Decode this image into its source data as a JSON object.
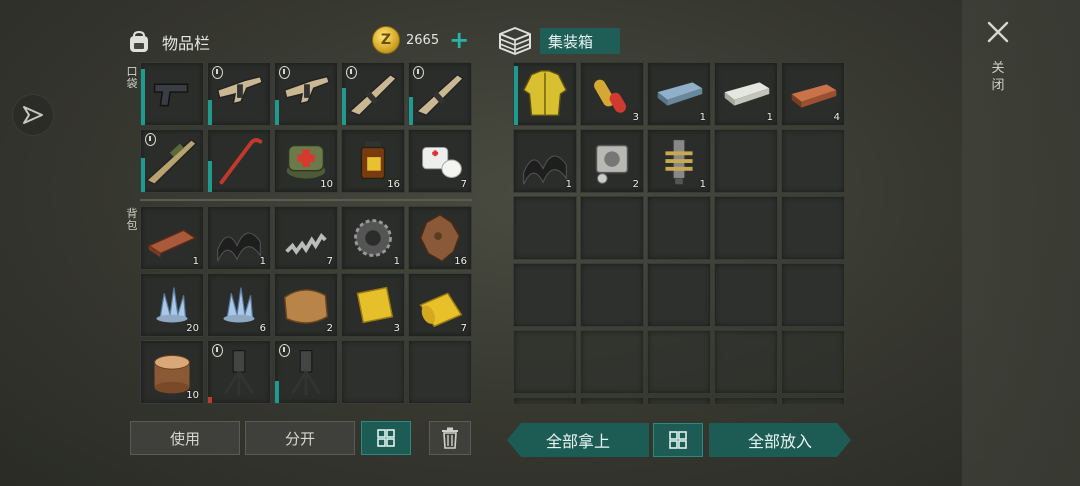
{
  "inventory": {
    "title": "物品栏",
    "pocket_label": "口袋",
    "backpack_label": "背包",
    "coins": "2665",
    "coin_symbol": "Z"
  },
  "box": {
    "title": "集装箱"
  },
  "close": {
    "label": "关闭"
  },
  "buttons": {
    "use": "使用",
    "split": "分开",
    "take_all": "全部拿上",
    "put_all": "全部放入"
  },
  "pocket_items": [
    {
      "name": "pistol-icon",
      "count": "",
      "durability": 0.9,
      "shield": false
    },
    {
      "name": "smg-icon",
      "count": "",
      "durability": 0.4,
      "shield": true
    },
    {
      "name": "smg-icon",
      "count": "",
      "durability": 0.4,
      "shield": true
    },
    {
      "name": "assault-rifle-icon",
      "count": "",
      "durability": 0.6,
      "shield": true
    },
    {
      "name": "assault-rifle-icon",
      "count": "",
      "durability": 0.45,
      "shield": true
    },
    {
      "name": "shotgun-icon",
      "count": "",
      "durability": 0.55,
      "shield": true
    },
    {
      "name": "crowbar-icon",
      "count": "",
      "durability": 0.5,
      "shield": false
    },
    {
      "name": "medkit-bag-icon",
      "count": "10"
    },
    {
      "name": "medicine-bottle-icon",
      "count": "16"
    },
    {
      "name": "bandage-icon",
      "count": "7"
    }
  ],
  "backpack_items": [
    {
      "name": "wood-plank-icon",
      "count": "1"
    },
    {
      "name": "rubber-sheet-icon",
      "count": "1"
    },
    {
      "name": "spring-icon",
      "count": "7"
    },
    {
      "name": "gear-icon",
      "count": "1"
    },
    {
      "name": "hide-icon",
      "count": "16"
    },
    {
      "name": "crystal-icon",
      "count": "20"
    },
    {
      "name": "crystal-icon",
      "count": "6"
    },
    {
      "name": "leather-icon",
      "count": "2"
    },
    {
      "name": "yellow-cloth-icon",
      "count": "3"
    },
    {
      "name": "fabric-roll-icon",
      "count": "7"
    },
    {
      "name": "log-icon",
      "count": "10"
    },
    {
      "name": "turret-icon",
      "count": "",
      "durability": 0.1,
      "bar": "red",
      "shield": true
    },
    {
      "name": "turret-icon",
      "count": "",
      "durability": 0.35,
      "shield": true
    },
    {
      "name": "",
      "count": ""
    },
    {
      "name": "",
      "count": ""
    }
  ],
  "box_items": [
    {
      "name": "yellow-jacket-icon",
      "count": "",
      "durability": 0.95
    },
    {
      "name": "capsule-icon",
      "count": "3"
    },
    {
      "name": "steel-ingot-icon",
      "count": "1"
    },
    {
      "name": "aluminum-ingot-icon",
      "count": "1"
    },
    {
      "name": "copper-ingot-icon",
      "count": "4"
    },
    {
      "name": "rubber-sheet-icon",
      "count": "1"
    },
    {
      "name": "engine-block-icon",
      "count": "2"
    },
    {
      "name": "valve-icon",
      "count": "1"
    }
  ],
  "colors": {
    "accent": "#1d5c55",
    "accent_bright": "#28b4a6",
    "durability": "#1e9a8e",
    "low_durability": "#c23a2a"
  }
}
